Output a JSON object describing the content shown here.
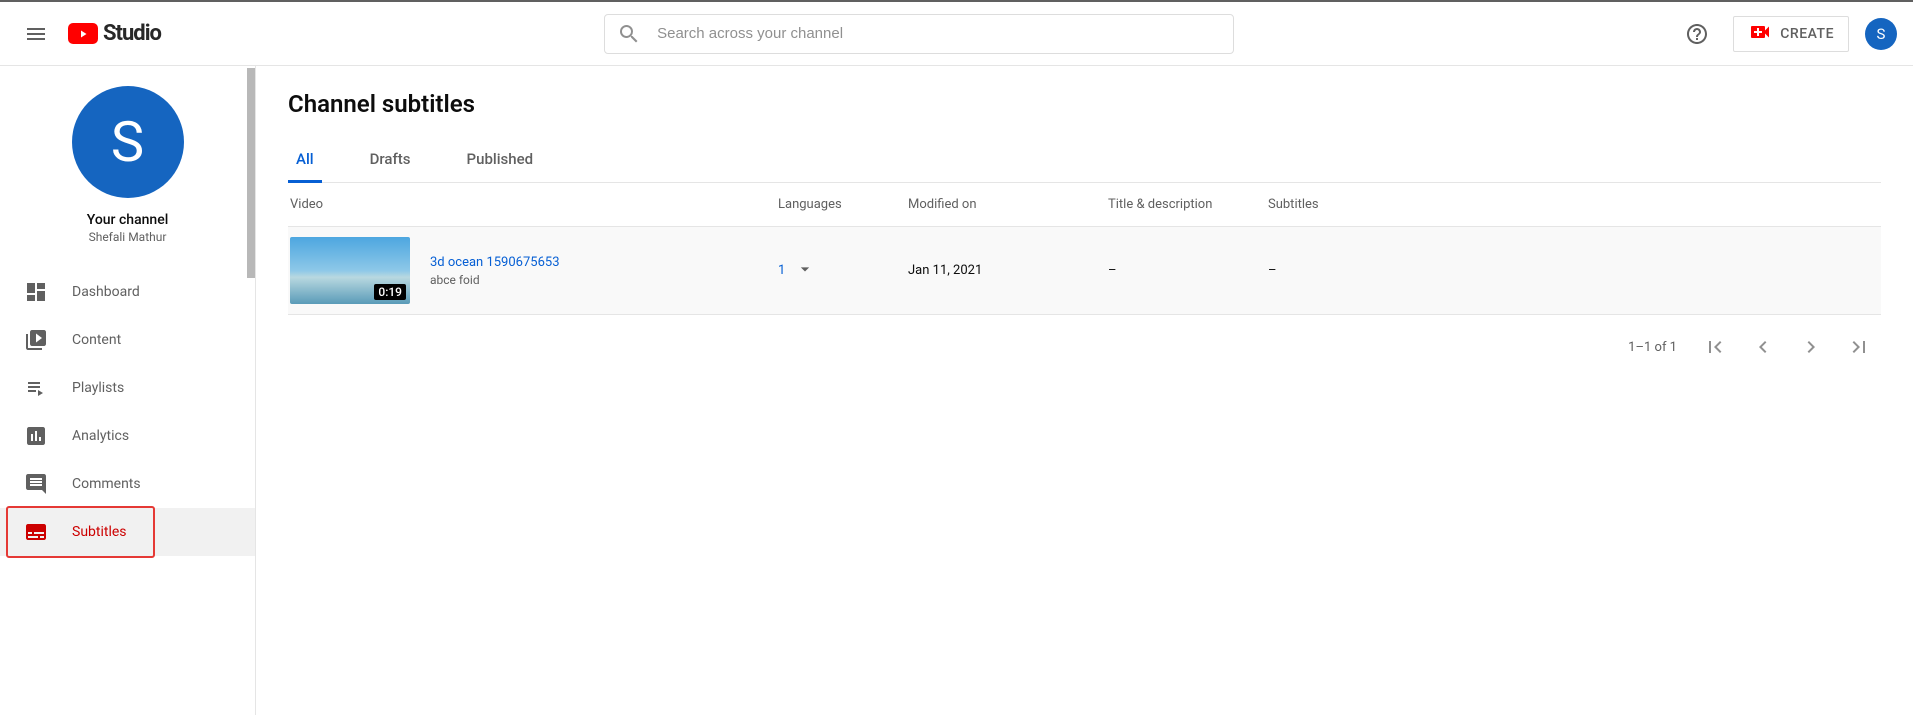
{
  "header": {
    "logo_text": "Studio",
    "search_placeholder": "Search across your channel",
    "create_label": "CREATE",
    "avatar_initial": "S"
  },
  "sidebar": {
    "channel_avatar_initial": "S",
    "your_channel_label": "Your channel",
    "channel_name": "Shefali Mathur",
    "items": [
      {
        "label": "Dashboard"
      },
      {
        "label": "Content"
      },
      {
        "label": "Playlists"
      },
      {
        "label": "Analytics"
      },
      {
        "label": "Comments"
      },
      {
        "label": "Subtitles"
      }
    ]
  },
  "main": {
    "page_title": "Channel subtitles",
    "tabs": [
      {
        "label": "All"
      },
      {
        "label": "Drafts"
      },
      {
        "label": "Published"
      }
    ],
    "columns": {
      "video": "Video",
      "languages": "Languages",
      "modified": "Modified on",
      "title_desc": "Title & description",
      "subtitles": "Subtitles"
    },
    "rows": [
      {
        "duration": "0:19",
        "title": "3d ocean 1590675653",
        "desc": "abce foid",
        "lang_count": "1",
        "modified": "Jan 11, 2021",
        "title_desc": "–",
        "subtitles": "–"
      }
    ],
    "pagination": {
      "range": "1–1 of 1"
    }
  }
}
